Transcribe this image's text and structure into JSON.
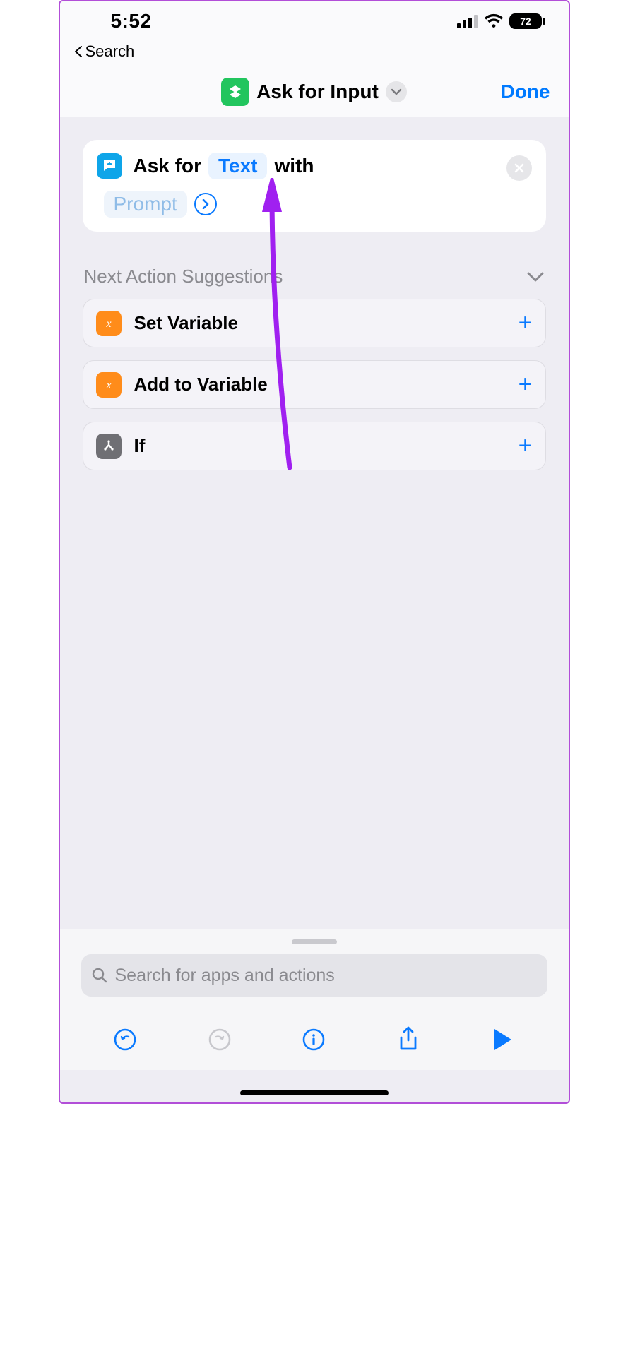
{
  "status": {
    "time": "5:52",
    "battery": "72"
  },
  "back_label": "Search",
  "header": {
    "title": "Ask for Input",
    "done": "Done"
  },
  "action": {
    "prefix": "Ask for",
    "token": "Text",
    "suffix": "with",
    "prompt_token": "Prompt"
  },
  "suggestions": {
    "heading": "Next Action Suggestions",
    "items": [
      {
        "label": "Set Variable",
        "icon": "variable",
        "color": "orange"
      },
      {
        "label": "Add to Variable",
        "icon": "variable",
        "color": "orange"
      },
      {
        "label": "If",
        "icon": "branch",
        "color": "gray"
      }
    ]
  },
  "search": {
    "placeholder": "Search for apps and actions"
  }
}
